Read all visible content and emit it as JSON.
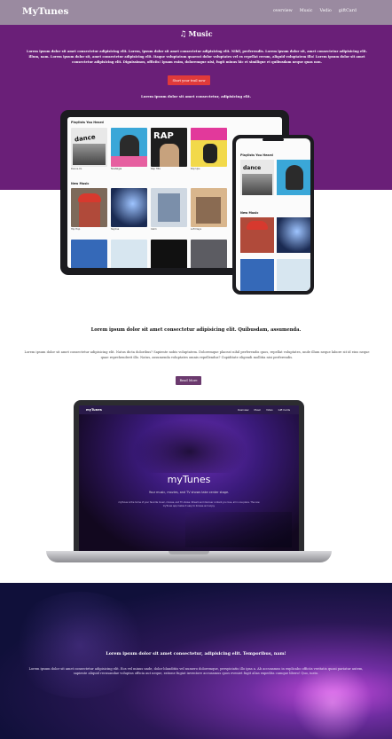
{
  "navbar": {
    "brand": "MyTunes",
    "links": [
      "overview",
      "Music",
      "Vedio",
      "giftCard"
    ]
  },
  "hero": {
    "icon": "music-note-icon",
    "title": "Music",
    "paragraph": "Lorem ipsum dolor sit amet consectetur adipisicing elit. Lorem, ipsum dolor sit amet consectetur adipisicing elit. Nihil, perferendis. Lorem ipsum dolor sit, amet consectetur adipisicing elit. Illum, nam. Lorem ipsum dolor sit, amet consectetur adipisicing elit. Itaque voluptatum quaerat dolor voluptates vel ex repellat rerum, aliquid voluptatem illo! Lorem ipsum dolor sit amet consectetur adipisicing elit. Dignissimos, officiis! Ipsam enim, doloremque nisi, fugit minus hic et similique et quibusdam neque quas non.",
    "cta_label": "Start your trail now",
    "subtitle": "Lorem ipsum dolor sit amet consectetur, adipisicing elit."
  },
  "tablet": {
    "section1": "Playlists You Heard",
    "section2": "New Music",
    "albums1": [
      "Dance-XL",
      "Nostalgia",
      "Rap Hits",
      "Pop Ups"
    ],
    "albums2": [
      "Hip Hop",
      "Skyline",
      "Calm",
      "Lofi Days"
    ]
  },
  "phone": {
    "section1": "Playlists You Heard",
    "section2": "New Music"
  },
  "article": {
    "title": "Lorem ipsum dolor sit amet consectetur adipisicing elit. Quibusdam, assumenda.",
    "text": "Lorem ipsum dolor sit amet consectetur adipisicing elit. Natus dicta doloribus? Sapiente nobis voluptatem. Doloremque placeat nihil perferendis quos, repellat voluptates, unde illum neque labore sit id eius neque quae reprehenderit illo. Natus, assumenda voluptates omnis repellendus? Cupiditate eligendi mollitia nisi perferendis.",
    "button_label": "Read More"
  },
  "laptop": {
    "brand": "myTunes",
    "links": [
      "Overview",
      "Music",
      "Video",
      "Gift Cards"
    ],
    "title": "myTunes",
    "subtitle": "Your music, movies, and TV shows take center stage.",
    "tiny_text": "myTunes is the home of your favorite music, movies, and TV shows. Stream and discover content you love, all in one place. The new myTunes app makes it easy to browse and enjoy."
  },
  "footer": {
    "title": "Lorem ipsum dolor sit amet consectetur, adipisicing elit. Temporibus, nam!",
    "text": "Lorem ipsum dolor sit amet consectetur adipisicing elit. Eos vel minus unde, dolor blanditiis vel numero doloremque, perspiciatis illo ipsa a. Ab accusamus in explicabo officiis veritatis quasi pariatur autem, sapiente aliquid recusandae voluptas officia aut neque, ratione fugiat inventore accusamus quos eveniet fugit alias expedita cumque libero! Quo, iusto."
  },
  "colors": {
    "navbar": "#9a8aa0",
    "hero": "#6a1f78",
    "cta": "#e03a3a",
    "read_more": "#6b3a6e"
  }
}
